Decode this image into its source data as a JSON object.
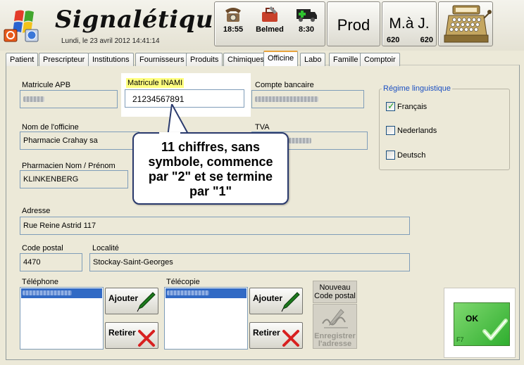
{
  "header": {
    "app_title": "Signalétiques",
    "date_line": "Lundi, le 23 avril 2012  14:41:14",
    "toolbar": {
      "phone_time": "18:55",
      "belmed_label": "Belmed",
      "ambulance_time": "8:30",
      "prod_label": "Prod",
      "maj_label": "M.à J.",
      "maj_count_left": "620",
      "maj_count_right": "620"
    }
  },
  "tabs": [
    {
      "label": "Patient"
    },
    {
      "label": "Prescripteur"
    },
    {
      "label": "Institutions"
    },
    {
      "label": "Fournisseurs"
    },
    {
      "label": "Produits"
    },
    {
      "label": "Chimiques"
    },
    {
      "label": "Officine",
      "active": true
    },
    {
      "label": "Labo"
    },
    {
      "label": "Famille"
    },
    {
      "label": "Comptoir"
    }
  ],
  "form": {
    "matricule_apb_label": "Matricule APB",
    "matricule_inami_label": "Matricule INAMI",
    "matricule_inami_value": "21234567891",
    "compte_bancaire_label": "Compte bancaire",
    "nom_officine_label": "Nom de l'officine",
    "nom_officine_value": "Pharmacie Crahay sa",
    "tva_label": "TVA",
    "pharmacien_label": "Pharmacien Nom / Prénom",
    "pharmacien_value": "KLINKENBERG",
    "adresse_label": "Adresse",
    "adresse_value": "Rue Reine Astrid 117",
    "code_postal_label": "Code postal",
    "code_postal_value": "4470",
    "localite_label": "Localité",
    "localite_value": "Stockay-Saint-Georges",
    "telephone_label": "Téléphone",
    "telecopie_label": "Télécopie"
  },
  "language": {
    "legend": "Régime linguistique",
    "options": [
      {
        "label": "Français",
        "checked": true
      },
      {
        "label": "Nederlands",
        "checked": false
      },
      {
        "label": "Deutsch",
        "checked": false
      }
    ]
  },
  "buttons": {
    "ajouter": "Ajouter",
    "retirer": "Retirer",
    "nouveau_line1": "Nouveau",
    "nouveau_line2": "Code postal",
    "enregistrer_line1": "Enregistrer",
    "enregistrer_line2": "l'adresse",
    "ok": "OK",
    "ok_key": "F7"
  },
  "callout": {
    "line1": "11 chiffres, sans",
    "line2": "symbole, commence",
    "line3": "par \"2\" et se termine",
    "line4": "par \"1\""
  },
  "colors": {
    "inami_highlight": "#ffff7f",
    "selection": "#316ac5",
    "ok_green": "#2fae2f",
    "legend_blue": "#1a4fc2",
    "callout_border": "#2a3a6d"
  }
}
